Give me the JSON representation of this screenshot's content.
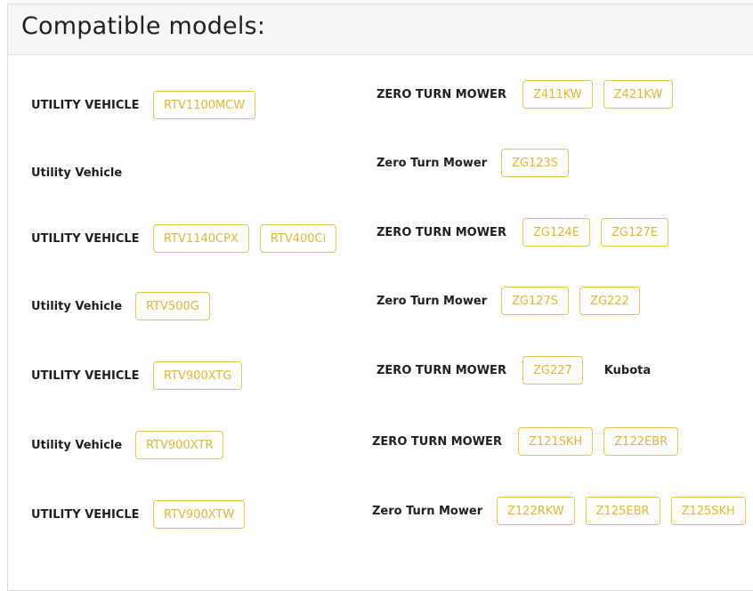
{
  "title": "Compatible models:",
  "left": [
    {
      "category": "UTILITY VEHICLE",
      "models": [
        "RTV1100MCW"
      ]
    },
    {
      "category": "Utility Vehicle",
      "models": []
    },
    {
      "category": "UTILITY VEHICLE",
      "models": [
        "RTV1140CPX",
        "RTV400Ci"
      ]
    },
    {
      "category": "Utility Vehicle",
      "models": [
        "RTV500G"
      ]
    },
    {
      "category": "UTILITY VEHICLE",
      "models": [
        "RTV900XTG"
      ]
    },
    {
      "category": "Utility Vehicle",
      "models": [
        "RTV900XTR"
      ]
    },
    {
      "category": "UTILITY VEHICLE",
      "models": [
        "RTV900XTW"
      ]
    }
  ],
  "right": [
    {
      "category": "ZERO TURN MOWER",
      "models": [
        "Z411KW",
        "Z421KW"
      ]
    },
    {
      "category": "Zero Turn Mower",
      "models": [
        "ZG123S"
      ]
    },
    {
      "category": "ZERO TURN MOWER",
      "models": [
        "ZG124E",
        "ZG127E"
      ]
    },
    {
      "category": "Zero Turn Mower",
      "models": [
        "ZG127S",
        "ZG222"
      ]
    },
    {
      "category": "ZERO TURN MOWER",
      "models": [
        "ZG227"
      ],
      "brand": "Kubota"
    },
    {
      "category": "ZERO TURN MOWER",
      "models": [
        "Z121SKH",
        "Z122EBR"
      ]
    },
    {
      "category": "Zero Turn Mower",
      "models": [
        "Z122RKW",
        "Z125EBR",
        "Z125SKH"
      ]
    }
  ]
}
